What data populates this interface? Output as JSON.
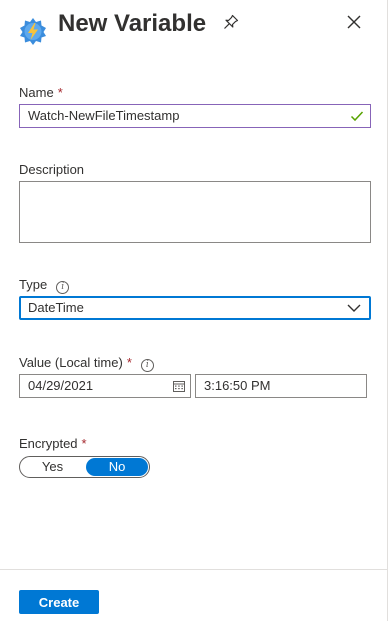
{
  "header": {
    "title": "New Variable",
    "icon": "automation-account-icon",
    "pin_icon": "pin-icon",
    "close_icon": "close-icon"
  },
  "fields": {
    "name": {
      "label": "Name",
      "required_marker": "*",
      "value": "Watch-NewFileTimestamp",
      "status_icon": "checkmark-icon"
    },
    "description": {
      "label": "Description",
      "value": ""
    },
    "type": {
      "label": "Type",
      "info_icon": "info-icon",
      "value": "DateTime"
    },
    "value": {
      "label": "Value (Local time)",
      "required_marker": "*",
      "info_icon": "info-icon",
      "date": "04/29/2021",
      "time": "3:16:50 PM"
    },
    "encrypted": {
      "label": "Encrypted",
      "required_marker": "*",
      "options": [
        "Yes",
        "No"
      ],
      "selected": "No"
    }
  },
  "footer": {
    "create_label": "Create"
  },
  "colors": {
    "accent": "#0078d4",
    "required": "#a4262c",
    "valid_border": "#8764b8",
    "valid_check": "#57a300"
  }
}
